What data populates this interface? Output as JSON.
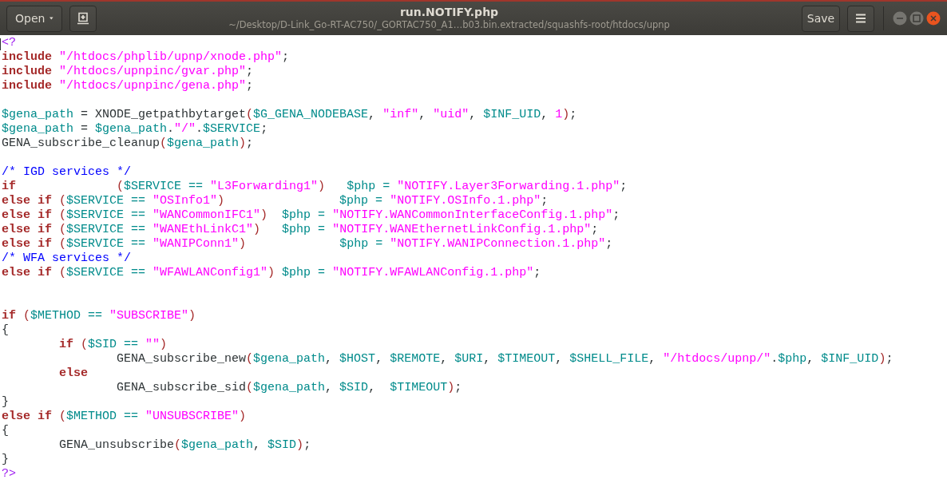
{
  "header": {
    "open_button": "Open",
    "title": "run.NOTIFY.php",
    "subtitle": "~/Desktop/D-Link_Go-RT-AC750/_GORTAC750_A1…b03.bin.extracted/squashfs-root/htdocs/upnp",
    "save_button": "Save"
  },
  "lines": [
    {
      "kind": "code",
      "tokens": [
        {
          "kind": "preproc",
          "text": "<?"
        }
      ]
    },
    {
      "kind": "code",
      "tokens": [
        {
          "kind": "keyword",
          "text": "include"
        },
        {
          "kind": "string",
          "text": " \"/htdocs/phplib/upnp/xnode.php\""
        },
        {
          "kind": "plain",
          "text": ";"
        }
      ]
    },
    {
      "kind": "code",
      "tokens": [
        {
          "kind": "keyword",
          "text": "include"
        },
        {
          "kind": "string",
          "text": " \"/htdocs/upnpinc/gvar.php\""
        },
        {
          "kind": "plain",
          "text": ";"
        }
      ]
    },
    {
      "kind": "code",
      "tokens": [
        {
          "kind": "keyword",
          "text": "include"
        },
        {
          "kind": "string",
          "text": " \"/htdocs/upnpinc/gena.php\""
        },
        {
          "kind": "plain",
          "text": ";"
        }
      ]
    },
    {
      "kind": "blank"
    },
    {
      "kind": "code",
      "tokens": [
        {
          "kind": "variable",
          "text": "$gena_path"
        },
        {
          "kind": "plain",
          "text": " = XNODE_getpathbytarget"
        },
        {
          "kind": "paren",
          "text": "("
        },
        {
          "kind": "variable",
          "text": "$G_GENA_NODEBASE"
        },
        {
          "kind": "plain",
          "text": ","
        },
        {
          "kind": "string",
          "text": " \"inf\""
        },
        {
          "kind": "plain",
          "text": ","
        },
        {
          "kind": "string",
          "text": " \"uid\""
        },
        {
          "kind": "plain",
          "text": ","
        },
        {
          "kind": "variable",
          "text": " $INF_UID"
        },
        {
          "kind": "plain",
          "text": ","
        },
        {
          "kind": "number",
          "text": " 1"
        },
        {
          "kind": "paren",
          "text": ")"
        },
        {
          "kind": "plain",
          "text": ";"
        }
      ]
    },
    {
      "kind": "code",
      "tokens": [
        {
          "kind": "variable",
          "text": "$gena_path"
        },
        {
          "kind": "plain",
          "text": " ="
        },
        {
          "kind": "variable",
          "text": " $gena_path"
        },
        {
          "kind": "plain",
          "text": "."
        },
        {
          "kind": "string",
          "text": "\"/\""
        },
        {
          "kind": "plain",
          "text": "."
        },
        {
          "kind": "variable",
          "text": "$SERVICE"
        },
        {
          "kind": "plain",
          "text": ";"
        }
      ]
    },
    {
      "kind": "code",
      "tokens": [
        {
          "kind": "plain",
          "text": "GENA_subscribe_cleanup"
        },
        {
          "kind": "paren",
          "text": "("
        },
        {
          "kind": "variable",
          "text": "$gena_path"
        },
        {
          "kind": "paren",
          "text": ")"
        },
        {
          "kind": "plain",
          "text": ";"
        }
      ]
    },
    {
      "kind": "blank"
    },
    {
      "kind": "code",
      "tokens": [
        {
          "kind": "comment",
          "text": "/* IGD services */"
        }
      ]
    },
    {
      "kind": "code",
      "tokens": [
        {
          "kind": "keyword",
          "text": "if"
        },
        {
          "kind": "paren",
          "text": "              ("
        },
        {
          "kind": "variable",
          "text": "$SERVICE =="
        },
        {
          "kind": "string",
          "text": " \"L3Forwarding1\""
        },
        {
          "kind": "paren",
          "text": ")"
        },
        {
          "kind": "variable",
          "text": "   $php ="
        },
        {
          "kind": "string",
          "text": " \"NOTIFY.Layer3Forwarding.1.php\""
        },
        {
          "kind": "plain",
          "text": ";"
        }
      ]
    },
    {
      "kind": "code",
      "tokens": [
        {
          "kind": "keyword",
          "text": "else if"
        },
        {
          "kind": "paren",
          "text": " ("
        },
        {
          "kind": "variable",
          "text": "$SERVICE =="
        },
        {
          "kind": "string",
          "text": " \"OSInfo1\""
        },
        {
          "kind": "paren",
          "text": ")"
        },
        {
          "kind": "variable",
          "text": "                $php ="
        },
        {
          "kind": "string",
          "text": " \"NOTIFY.OSInfo.1.php\""
        },
        {
          "kind": "plain",
          "text": ";"
        }
      ]
    },
    {
      "kind": "code",
      "tokens": [
        {
          "kind": "keyword",
          "text": "else if"
        },
        {
          "kind": "paren",
          "text": " ("
        },
        {
          "kind": "variable",
          "text": "$SERVICE =="
        },
        {
          "kind": "string",
          "text": " \"WANCommonIFC1\""
        },
        {
          "kind": "paren",
          "text": ")"
        },
        {
          "kind": "variable",
          "text": "  $php ="
        },
        {
          "kind": "string",
          "text": " \"NOTIFY.WANCommonInterfaceConfig.1.php\""
        },
        {
          "kind": "plain",
          "text": ";"
        }
      ]
    },
    {
      "kind": "code",
      "tokens": [
        {
          "kind": "keyword",
          "text": "else if"
        },
        {
          "kind": "paren",
          "text": " ("
        },
        {
          "kind": "variable",
          "text": "$SERVICE =="
        },
        {
          "kind": "string",
          "text": " \"WANEthLinkC1\""
        },
        {
          "kind": "paren",
          "text": ")"
        },
        {
          "kind": "variable",
          "text": "   $php ="
        },
        {
          "kind": "string",
          "text": " \"NOTIFY.WANEthernetLinkConfig.1.php\""
        },
        {
          "kind": "plain",
          "text": ";"
        }
      ]
    },
    {
      "kind": "code",
      "tokens": [
        {
          "kind": "keyword",
          "text": "else if"
        },
        {
          "kind": "paren",
          "text": " ("
        },
        {
          "kind": "variable",
          "text": "$SERVICE =="
        },
        {
          "kind": "string",
          "text": " \"WANIPConn1\""
        },
        {
          "kind": "paren",
          "text": ")"
        },
        {
          "kind": "variable",
          "text": "             $php ="
        },
        {
          "kind": "string",
          "text": " \"NOTIFY.WANIPConnection.1.php\""
        },
        {
          "kind": "plain",
          "text": ";"
        }
      ]
    },
    {
      "kind": "code",
      "tokens": [
        {
          "kind": "comment",
          "text": "/* WFA services */"
        }
      ]
    },
    {
      "kind": "code",
      "tokens": [
        {
          "kind": "keyword",
          "text": "else if"
        },
        {
          "kind": "paren",
          "text": " ("
        },
        {
          "kind": "variable",
          "text": "$SERVICE =="
        },
        {
          "kind": "string",
          "text": " \"WFAWLANConfig1\""
        },
        {
          "kind": "paren",
          "text": ")"
        },
        {
          "kind": "variable",
          "text": " $php ="
        },
        {
          "kind": "string",
          "text": " \"NOTIFY.WFAWLANConfig.1.php\""
        },
        {
          "kind": "plain",
          "text": ";"
        }
      ]
    },
    {
      "kind": "blank"
    },
    {
      "kind": "blank"
    },
    {
      "kind": "code",
      "tokens": [
        {
          "kind": "keyword",
          "text": "if"
        },
        {
          "kind": "paren",
          "text": " ("
        },
        {
          "kind": "variable",
          "text": "$METHOD =="
        },
        {
          "kind": "string",
          "text": " \"SUBSCRIBE\""
        },
        {
          "kind": "paren",
          "text": ")"
        }
      ]
    },
    {
      "kind": "code",
      "tokens": [
        {
          "kind": "plain",
          "text": "{"
        }
      ]
    },
    {
      "kind": "code",
      "tokens": [
        {
          "kind": "keyword",
          "text": "        if"
        },
        {
          "kind": "paren",
          "text": " ("
        },
        {
          "kind": "variable",
          "text": "$SID =="
        },
        {
          "kind": "string",
          "text": " \"\""
        },
        {
          "kind": "paren",
          "text": ")"
        }
      ]
    },
    {
      "kind": "code",
      "tokens": [
        {
          "kind": "plain",
          "text": "                GENA_subscribe_new"
        },
        {
          "kind": "paren",
          "text": "("
        },
        {
          "kind": "variable",
          "text": "$gena_path"
        },
        {
          "kind": "plain",
          "text": ","
        },
        {
          "kind": "variable",
          "text": " $HOST"
        },
        {
          "kind": "plain",
          "text": ","
        },
        {
          "kind": "variable",
          "text": " $REMOTE"
        },
        {
          "kind": "plain",
          "text": ","
        },
        {
          "kind": "variable",
          "text": " $URI"
        },
        {
          "kind": "plain",
          "text": ","
        },
        {
          "kind": "variable",
          "text": " $TIMEOUT"
        },
        {
          "kind": "plain",
          "text": ","
        },
        {
          "kind": "variable",
          "text": " $SHELL_FILE"
        },
        {
          "kind": "plain",
          "text": ","
        },
        {
          "kind": "string",
          "text": " \"/htdocs/upnp/\""
        },
        {
          "kind": "plain",
          "text": "."
        },
        {
          "kind": "variable",
          "text": "$php"
        },
        {
          "kind": "plain",
          "text": ","
        },
        {
          "kind": "variable",
          "text": " $INF_UID"
        },
        {
          "kind": "paren",
          "text": ")"
        },
        {
          "kind": "plain",
          "text": ";"
        }
      ]
    },
    {
      "kind": "code",
      "tokens": [
        {
          "kind": "keyword",
          "text": "        else"
        }
      ]
    },
    {
      "kind": "code",
      "tokens": [
        {
          "kind": "plain",
          "text": "                GENA_subscribe_sid"
        },
        {
          "kind": "paren",
          "text": "("
        },
        {
          "kind": "variable",
          "text": "$gena_path"
        },
        {
          "kind": "plain",
          "text": ","
        },
        {
          "kind": "variable",
          "text": " $SID"
        },
        {
          "kind": "plain",
          "text": ","
        },
        {
          "kind": "variable",
          "text": "  $TIMEOUT"
        },
        {
          "kind": "paren",
          "text": ")"
        },
        {
          "kind": "plain",
          "text": ";"
        }
      ]
    },
    {
      "kind": "code",
      "tokens": [
        {
          "kind": "plain",
          "text": "}"
        }
      ]
    },
    {
      "kind": "code",
      "tokens": [
        {
          "kind": "keyword",
          "text": "else if"
        },
        {
          "kind": "paren",
          "text": " ("
        },
        {
          "kind": "variable",
          "text": "$METHOD =="
        },
        {
          "kind": "string",
          "text": " \"UNSUBSCRIBE\""
        },
        {
          "kind": "paren",
          "text": ")"
        }
      ]
    },
    {
      "kind": "code",
      "tokens": [
        {
          "kind": "plain",
          "text": "{"
        }
      ]
    },
    {
      "kind": "code",
      "tokens": [
        {
          "kind": "plain",
          "text": "        GENA_unsubscribe"
        },
        {
          "kind": "paren",
          "text": "("
        },
        {
          "kind": "variable",
          "text": "$gena_path"
        },
        {
          "kind": "plain",
          "text": ","
        },
        {
          "kind": "variable",
          "text": " $SID"
        },
        {
          "kind": "paren",
          "text": ")"
        },
        {
          "kind": "plain",
          "text": ";"
        }
      ]
    },
    {
      "kind": "code",
      "tokens": [
        {
          "kind": "plain",
          "text": "}"
        }
      ]
    },
    {
      "kind": "code",
      "tokens": [
        {
          "kind": "preproc",
          "text": "?>"
        }
      ]
    }
  ]
}
